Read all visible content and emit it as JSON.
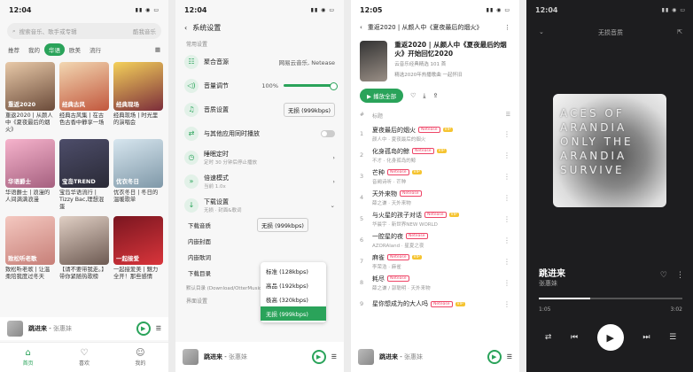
{
  "p1": {
    "time": "12:04",
    "search_placeholder": "搜索音乐、歌手或专辑",
    "source": "酷我音乐",
    "tabs": [
      "推荐",
      "我的",
      "华语",
      "欧美",
      "流行"
    ],
    "active_tab": "华语",
    "cards": [
      {
        "label": "重返2020",
        "caption": "重返2020 | 从颜人中《夏夜最后的烟火》",
        "c1": "#e8c9a8",
        "c2": "#6b4b3a"
      },
      {
        "label": "经典古风",
        "caption": "经典古风集 | 在古色古香中静享一场",
        "c1": "#f2d7b2",
        "c2": "#c2573d"
      },
      {
        "label": "经典现场",
        "caption": "经典现场 | 时光里的演唱会",
        "c1": "#f4d15a",
        "c2": "#7c2d3b"
      },
      {
        "label": "华语爵士",
        "caption": "华语爵士 | 浪漫的人间满满浪漫",
        "c1": "#f6b3cc",
        "c2": "#a5607f"
      },
      {
        "label": "宝岛TREND",
        "caption": "宝岛华语流行 | Tizzy Bac,理想混蛋",
        "c1": "#4d4d6a",
        "c2": "#2a2a36"
      },
      {
        "label": "优衣冬日",
        "caption": "优衣冬日 | 冬日的温暖歌单",
        "c1": "#d7e6ef",
        "c2": "#7f98a8"
      },
      {
        "label": "致松听老歌",
        "caption": "致松听老歌 | 让温柔陪我度过冬天",
        "c1": "#f4c8c0",
        "c2": "#c77f78"
      },
      {
        "label": "",
        "caption": "【请不要带我走。】带你紧随热歌榜",
        "c1": "#e0cfc4",
        "c2": "#6d5a52"
      },
      {
        "label": "一起接爱",
        "caption": "一起接爱美 | 魅力全开！那些感情",
        "c1": "#7a1620",
        "c2": "#d9353b"
      }
    ],
    "mini_title": "跳进来",
    "mini_artist": "张惠妹",
    "nav": [
      "首页",
      "喜欢",
      "我的"
    ]
  },
  "p2": {
    "time": "12:04",
    "title": "系统设置",
    "section": "常用设置",
    "rows": [
      {
        "icon": "☷",
        "label": "聚合音源",
        "value": "网易云音乐, Netease"
      },
      {
        "icon": "◁)",
        "label": "音量调节",
        "value": "100%"
      },
      {
        "icon": "♫",
        "label": "音质设置",
        "value": "无损 (999kbps)"
      },
      {
        "icon": "⇄",
        "label": "与其他应用同时播放",
        "value": ""
      },
      {
        "icon": "◷",
        "label": "睡眠定时",
        "sub": "定时 30 分钟后停止播放",
        "value": ""
      },
      {
        "icon": "»",
        "label": "倍速模式",
        "sub": "当前 1.0x",
        "value": ""
      },
      {
        "icon": "↓",
        "label": "下载设置",
        "sub": "无损 · 封面&歌词",
        "value": ""
      }
    ],
    "sub_rows": [
      {
        "k": "下载音质",
        "v": "无损 (999kbps)"
      },
      {
        "k": "内嵌封面",
        "v": ""
      },
      {
        "k": "内嵌歌词",
        "v": ""
      },
      {
        "k": "下载目录",
        "v": ""
      }
    ],
    "dir_hint": "默认目录 (Download/OtterMusic)",
    "options": [
      "标准 (128kbps)",
      "高品 (192kbps)",
      "极高 (320kbps)",
      "无损 (999kbps)"
    ],
    "selected_option": "无损 (999kbps)",
    "section2": "界面设置",
    "mini_title": "跳进来",
    "mini_artist": "张惠妹"
  },
  "p3": {
    "time": "12:05",
    "header": "重返2020 | 从颜人中《夏夜最后的烟火》",
    "album_title": "重返2020 | 从颜人中《夏夜最后的烟火》开始回忆2020",
    "album_src": "云音乐经典精选",
    "count": "101 首",
    "album_desc": "精选2020年热播歌曲 一起怀旧",
    "play_all": "播放全部",
    "col_title": "标题",
    "tracks": [
      {
        "n": "1",
        "t": "夏夜最后的烟火",
        "a": "颜人中 · 夏夜最后的烟火"
      },
      {
        "n": "2",
        "t": "化身孤岛的鲸",
        "a": "不才 · 化身孤岛的鲸"
      },
      {
        "n": "3",
        "t": "芒种",
        "a": "音阙诗听 · 芒种"
      },
      {
        "n": "4",
        "t": "天外来物",
        "a": "薛之谦 · 天外来物"
      },
      {
        "n": "5",
        "t": "与火星的孩子对话",
        "a": "华晨宇 · 新世界NEW WORLD"
      },
      {
        "n": "6",
        "t": "一腔星的夜",
        "a": "AZORAland · 星夏之夜"
      },
      {
        "n": "7",
        "t": "麻雀",
        "a": "李荣浩 · 麻雀"
      },
      {
        "n": "8",
        "t": "耗尽",
        "a": "薛之谦 / 郭聪明 · 天外来物"
      },
      {
        "n": "9",
        "t": "星你想成为的大人吗",
        "a": ""
      }
    ],
    "mini_title": "跳进来",
    "mini_artist": "张惠妹"
  },
  "p4": {
    "time": "12:04",
    "quality": "无损音质",
    "art_text": "ACES OF ARANDIA ONLY THE ARANDIA SURVIVE",
    "song": "跳进来",
    "artist": "张惠妹",
    "elapsed": "1:05",
    "total": "3:02",
    "progress": 0.36
  }
}
